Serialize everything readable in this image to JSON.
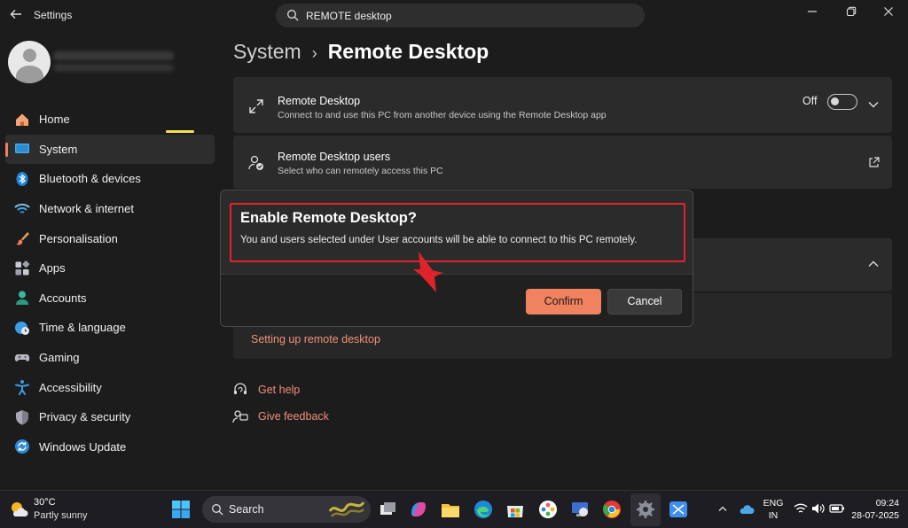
{
  "window": {
    "title": "Settings",
    "back_icon": "back-arrow-icon"
  },
  "search": {
    "value": "REMOTE desktop"
  },
  "nav": {
    "items": [
      {
        "label": "Home",
        "icon": "home-icon"
      },
      {
        "label": "System",
        "icon": "system-icon",
        "active": true
      },
      {
        "label": "Bluetooth & devices",
        "icon": "bluetooth-icon"
      },
      {
        "label": "Network & internet",
        "icon": "wifi-icon"
      },
      {
        "label": "Personalisation",
        "icon": "brush-icon"
      },
      {
        "label": "Apps",
        "icon": "apps-icon"
      },
      {
        "label": "Accounts",
        "icon": "accounts-icon"
      },
      {
        "label": "Time & language",
        "icon": "globe-clock-icon"
      },
      {
        "label": "Gaming",
        "icon": "gamepad-icon"
      },
      {
        "label": "Accessibility",
        "icon": "accessibility-icon"
      },
      {
        "label": "Privacy & security",
        "icon": "shield-icon"
      },
      {
        "label": "Windows Update",
        "icon": "update-icon"
      }
    ]
  },
  "breadcrumb": {
    "parent": "System",
    "separator": "›",
    "current": "Remote Desktop"
  },
  "remote_desktop_card": {
    "title": "Remote Desktop",
    "subtitle": "Connect to and use this PC from another device using the Remote Desktop app",
    "toggle_label": "Off",
    "toggle_on": false
  },
  "users_card": {
    "title": "Remote Desktop users",
    "subtitle": "Select who can remotely access this PC"
  },
  "related": {
    "link": "Setting up remote desktop"
  },
  "help": {
    "get_help": "Get help",
    "give_feedback": "Give feedback"
  },
  "dialog": {
    "title": "Enable Remote Desktop?",
    "message": "You and users selected under User accounts will be able to connect to this PC remotely.",
    "confirm": "Confirm",
    "cancel": "Cancel"
  },
  "taskbar": {
    "weather": {
      "temp": "30°C",
      "condition": "Partly sunny"
    },
    "search_label": "Search",
    "language": {
      "line1": "ENG",
      "line2": "IN"
    },
    "clock": {
      "time": "09:24",
      "date": "28-07-2025"
    }
  },
  "colors": {
    "accent": "#f08260",
    "highlight_box": "#e0232a",
    "background": "#1c1c1c"
  }
}
